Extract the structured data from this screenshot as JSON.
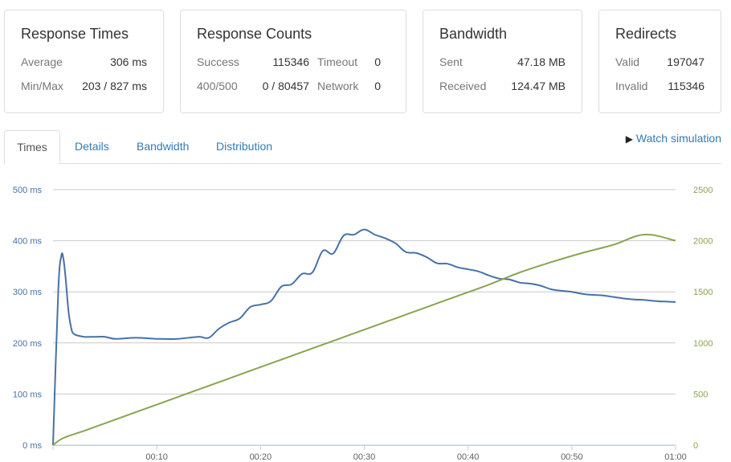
{
  "stats": {
    "response_times": {
      "title": "Response Times",
      "average_label": "Average",
      "average_value": "306 ms",
      "minmax_label": "Min/Max",
      "minmax_value": "203 / 827 ms"
    },
    "response_counts": {
      "title": "Response Counts",
      "success_label": "Success",
      "success_value": "115346",
      "timeout_label": "Timeout",
      "timeout_value": "0",
      "status_label": "400/500",
      "status_value": "0 / 80457",
      "network_label": "Network",
      "network_value": "0"
    },
    "bandwidth": {
      "title": "Bandwidth",
      "sent_label": "Sent",
      "sent_value": "47.18 MB",
      "received_label": "Received",
      "received_value": "124.47 MB"
    },
    "redirects": {
      "title": "Redirects",
      "valid_label": "Valid",
      "valid_value": "197047",
      "invalid_label": "Invalid",
      "invalid_value": "115346"
    }
  },
  "tabs": [
    {
      "label": "Times",
      "active": true
    },
    {
      "label": "Details",
      "active": false
    },
    {
      "label": "Bandwidth",
      "active": false
    },
    {
      "label": "Distribution",
      "active": false
    }
  ],
  "watch_simulation": {
    "label": "Watch simulation",
    "icon": "play-icon"
  },
  "colors": {
    "response_time": "#4572a7",
    "clients": "#89a54e",
    "grid": "#c8c8c8",
    "link": "#337ab7"
  },
  "chart_data": {
    "type": "line",
    "x_unit": "seconds",
    "x_ticks": [
      "00:10",
      "00:20",
      "00:30",
      "00:40",
      "00:50",
      "01:00"
    ],
    "x_tick_values": [
      10,
      20,
      30,
      40,
      50,
      60
    ],
    "xlim": [
      0,
      60
    ],
    "y_left": {
      "ticks": [
        "0 ms",
        "100 ms",
        "200 ms",
        "300 ms",
        "400 ms",
        "500 ms"
      ],
      "tick_values": [
        0,
        100,
        200,
        300,
        400,
        500
      ],
      "lim": [
        0,
        500
      ]
    },
    "y_right": {
      "ticks": [
        "0",
        "500",
        "1000",
        "1500",
        "2000",
        "2500"
      ],
      "tick_values": [
        0,
        500,
        1000,
        1500,
        2000,
        2500
      ],
      "lim": [
        0,
        2500
      ]
    },
    "grid": true,
    "series": [
      {
        "axis": "left",
        "color": "#4572a7",
        "x": [
          0,
          0.5,
          0.8,
          1.0,
          1.2,
          1.5,
          1.8,
          2.0,
          2.3,
          3,
          4,
          5,
          6,
          8,
          10,
          12,
          14,
          15,
          16,
          17,
          18,
          19,
          20,
          21,
          22,
          23,
          24,
          25,
          26,
          27,
          28,
          29,
          30,
          31,
          32,
          33,
          34,
          35,
          36,
          37,
          38,
          39,
          40,
          41,
          42,
          43,
          44,
          45,
          46,
          47,
          48,
          49,
          50,
          51,
          52,
          53,
          54,
          55,
          56,
          57,
          58,
          59,
          60
        ],
        "y": [
          0,
          300,
          370,
          365,
          330,
          260,
          225,
          218,
          215,
          212,
          212,
          212,
          208,
          210,
          208,
          208,
          212,
          210,
          228,
          240,
          248,
          270,
          275,
          282,
          310,
          315,
          335,
          338,
          380,
          375,
          410,
          412,
          422,
          412,
          405,
          395,
          378,
          376,
          368,
          356,
          355,
          348,
          344,
          340,
          332,
          326,
          324,
          318,
          316,
          312,
          305,
          302,
          300,
          296,
          294,
          293,
          290,
          287,
          285,
          284,
          282,
          281,
          280
        ]
      },
      {
        "axis": "right",
        "color": "#89a54e",
        "x": [
          0,
          1,
          3,
          6,
          9,
          12,
          15,
          18,
          21,
          24,
          27,
          30,
          33,
          36,
          39,
          42,
          45,
          48,
          51,
          54,
          57,
          60
        ],
        "y": [
          0,
          70,
          140,
          250,
          360,
          470,
          580,
          690,
          800,
          910,
          1020,
          1130,
          1240,
          1350,
          1460,
          1570,
          1690,
          1790,
          1880,
          1960,
          2060,
          2000
        ]
      }
    ]
  }
}
